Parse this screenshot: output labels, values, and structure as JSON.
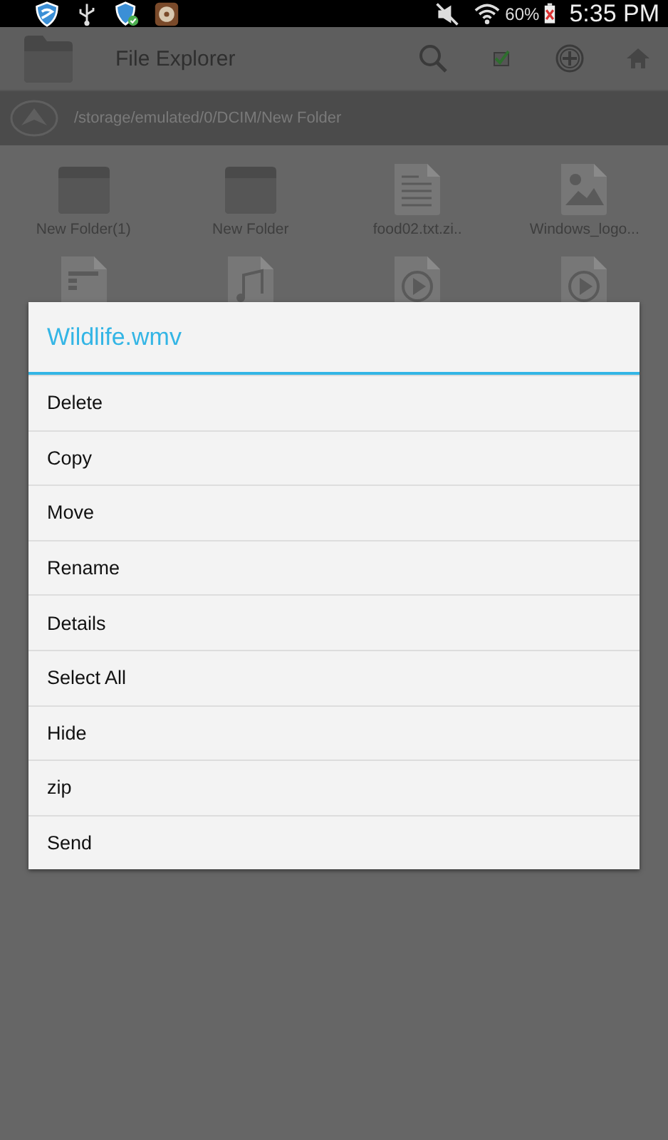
{
  "status_bar": {
    "battery": "60%",
    "time": "5:35 PM"
  },
  "action_bar": {
    "title": "File Explorer"
  },
  "path": "/storage/emulated/0/DCIM/New Folder",
  "files": [
    {
      "kind": "folder",
      "name": "New Folder(1)"
    },
    {
      "kind": "folder",
      "name": "New Folder"
    },
    {
      "kind": "text",
      "name": "food02.txt.zi.."
    },
    {
      "kind": "image",
      "name": "Windows_logo..."
    },
    {
      "kind": "document"
    },
    {
      "kind": "music"
    },
    {
      "kind": "video"
    },
    {
      "kind": "video"
    }
  ],
  "dialog": {
    "title": "Wildlife.wmv",
    "items": [
      "Delete",
      "Copy",
      "Move",
      "Rename",
      "Details",
      "Select All",
      "Hide",
      "zip",
      "Send"
    ]
  }
}
